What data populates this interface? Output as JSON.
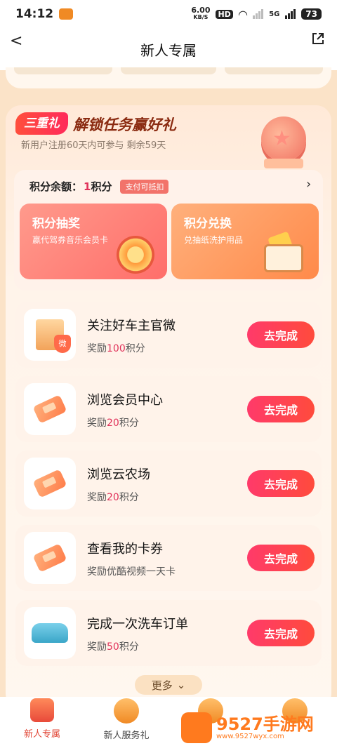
{
  "status_bar": {
    "time": "14:12",
    "net_speed_top": "6.00",
    "net_speed_unit": "KB/S",
    "hd_label": "HD",
    "signal_label": "5G",
    "battery": "73"
  },
  "header": {
    "title": "新人专属"
  },
  "panel": {
    "badge": "三重礼",
    "title": "解锁任务赢好礼",
    "subtitle": "新用户注册60天内可参与 剩余59天"
  },
  "points": {
    "label": "积分余额：",
    "value": "1",
    "unit": "积分",
    "tag": "支付可抵扣"
  },
  "features": [
    {
      "title": "积分抽奖",
      "subtitle": "赢代驾券音乐会员卡"
    },
    {
      "title": "积分兑换",
      "subtitle": "兑抽纸洗护用品"
    }
  ],
  "tasks": [
    {
      "title": "关注好车主官微",
      "reward_prefix": "奖励",
      "reward_value": "100",
      "reward_suffix": "积分",
      "button": "去完成",
      "icon": "building-shield-icon"
    },
    {
      "title": "浏览会员中心",
      "reward_prefix": "奖励",
      "reward_value": "20",
      "reward_suffix": "积分",
      "button": "去完成",
      "icon": "ticket-icon"
    },
    {
      "title": "浏览云农场",
      "reward_prefix": "奖励",
      "reward_value": "20",
      "reward_suffix": "积分",
      "button": "去完成",
      "icon": "ticket-icon"
    },
    {
      "title": "查看我的卡券",
      "reward_prefix": "奖励优酷视频一天卡",
      "reward_value": "",
      "reward_suffix": "",
      "button": "去完成",
      "icon": "ticket-icon"
    },
    {
      "title": "完成一次洗车订单",
      "reward_prefix": "奖励",
      "reward_value": "50",
      "reward_suffix": "积分",
      "button": "去完成",
      "icon": "car-icon"
    }
  ],
  "more": {
    "label": "更多"
  },
  "bottom_nav": [
    {
      "label": "新人专属",
      "active": true
    },
    {
      "label": "新人服务礼",
      "active": false
    },
    {
      "label": "",
      "active": false
    },
    {
      "label": "",
      "active": false
    }
  ],
  "watermark": {
    "text": "9527手游网",
    "url": "www.9527wyx.com"
  },
  "colors": {
    "accent": "#e24a3a",
    "button_gradient_start": "#ff3a6a",
    "button_gradient_end": "#ff4b3c",
    "page_bg": "#fbe3c8"
  }
}
